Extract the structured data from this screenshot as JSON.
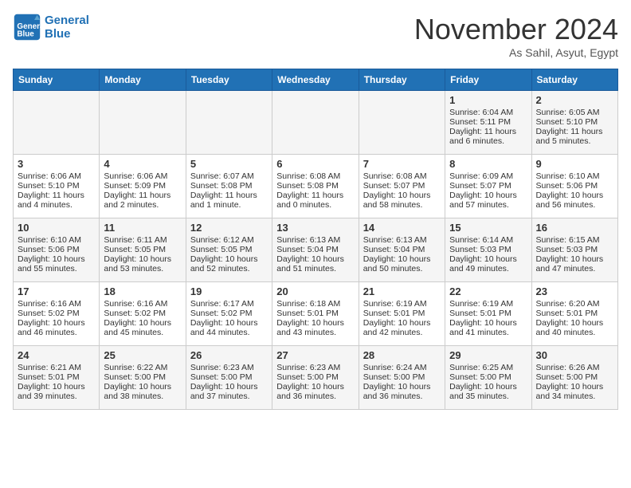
{
  "header": {
    "logo_line1": "General",
    "logo_line2": "Blue",
    "month": "November 2024",
    "location": "As Sahil, Asyut, Egypt"
  },
  "days_of_week": [
    "Sunday",
    "Monday",
    "Tuesday",
    "Wednesday",
    "Thursday",
    "Friday",
    "Saturday"
  ],
  "weeks": [
    [
      {
        "day": "",
        "info": ""
      },
      {
        "day": "",
        "info": ""
      },
      {
        "day": "",
        "info": ""
      },
      {
        "day": "",
        "info": ""
      },
      {
        "day": "",
        "info": ""
      },
      {
        "day": "1",
        "info": "Sunrise: 6:04 AM\nSunset: 5:11 PM\nDaylight: 11 hours and 6 minutes."
      },
      {
        "day": "2",
        "info": "Sunrise: 6:05 AM\nSunset: 5:10 PM\nDaylight: 11 hours and 5 minutes."
      }
    ],
    [
      {
        "day": "3",
        "info": "Sunrise: 6:06 AM\nSunset: 5:10 PM\nDaylight: 11 hours and 4 minutes."
      },
      {
        "day": "4",
        "info": "Sunrise: 6:06 AM\nSunset: 5:09 PM\nDaylight: 11 hours and 2 minutes."
      },
      {
        "day": "5",
        "info": "Sunrise: 6:07 AM\nSunset: 5:08 PM\nDaylight: 11 hours and 1 minute."
      },
      {
        "day": "6",
        "info": "Sunrise: 6:08 AM\nSunset: 5:08 PM\nDaylight: 11 hours and 0 minutes."
      },
      {
        "day": "7",
        "info": "Sunrise: 6:08 AM\nSunset: 5:07 PM\nDaylight: 10 hours and 58 minutes."
      },
      {
        "day": "8",
        "info": "Sunrise: 6:09 AM\nSunset: 5:07 PM\nDaylight: 10 hours and 57 minutes."
      },
      {
        "day": "9",
        "info": "Sunrise: 6:10 AM\nSunset: 5:06 PM\nDaylight: 10 hours and 56 minutes."
      }
    ],
    [
      {
        "day": "10",
        "info": "Sunrise: 6:10 AM\nSunset: 5:06 PM\nDaylight: 10 hours and 55 minutes."
      },
      {
        "day": "11",
        "info": "Sunrise: 6:11 AM\nSunset: 5:05 PM\nDaylight: 10 hours and 53 minutes."
      },
      {
        "day": "12",
        "info": "Sunrise: 6:12 AM\nSunset: 5:05 PM\nDaylight: 10 hours and 52 minutes."
      },
      {
        "day": "13",
        "info": "Sunrise: 6:13 AM\nSunset: 5:04 PM\nDaylight: 10 hours and 51 minutes."
      },
      {
        "day": "14",
        "info": "Sunrise: 6:13 AM\nSunset: 5:04 PM\nDaylight: 10 hours and 50 minutes."
      },
      {
        "day": "15",
        "info": "Sunrise: 6:14 AM\nSunset: 5:03 PM\nDaylight: 10 hours and 49 minutes."
      },
      {
        "day": "16",
        "info": "Sunrise: 6:15 AM\nSunset: 5:03 PM\nDaylight: 10 hours and 47 minutes."
      }
    ],
    [
      {
        "day": "17",
        "info": "Sunrise: 6:16 AM\nSunset: 5:02 PM\nDaylight: 10 hours and 46 minutes."
      },
      {
        "day": "18",
        "info": "Sunrise: 6:16 AM\nSunset: 5:02 PM\nDaylight: 10 hours and 45 minutes."
      },
      {
        "day": "19",
        "info": "Sunrise: 6:17 AM\nSunset: 5:02 PM\nDaylight: 10 hours and 44 minutes."
      },
      {
        "day": "20",
        "info": "Sunrise: 6:18 AM\nSunset: 5:01 PM\nDaylight: 10 hours and 43 minutes."
      },
      {
        "day": "21",
        "info": "Sunrise: 6:19 AM\nSunset: 5:01 PM\nDaylight: 10 hours and 42 minutes."
      },
      {
        "day": "22",
        "info": "Sunrise: 6:19 AM\nSunset: 5:01 PM\nDaylight: 10 hours and 41 minutes."
      },
      {
        "day": "23",
        "info": "Sunrise: 6:20 AM\nSunset: 5:01 PM\nDaylight: 10 hours and 40 minutes."
      }
    ],
    [
      {
        "day": "24",
        "info": "Sunrise: 6:21 AM\nSunset: 5:01 PM\nDaylight: 10 hours and 39 minutes."
      },
      {
        "day": "25",
        "info": "Sunrise: 6:22 AM\nSunset: 5:00 PM\nDaylight: 10 hours and 38 minutes."
      },
      {
        "day": "26",
        "info": "Sunrise: 6:23 AM\nSunset: 5:00 PM\nDaylight: 10 hours and 37 minutes."
      },
      {
        "day": "27",
        "info": "Sunrise: 6:23 AM\nSunset: 5:00 PM\nDaylight: 10 hours and 36 minutes."
      },
      {
        "day": "28",
        "info": "Sunrise: 6:24 AM\nSunset: 5:00 PM\nDaylight: 10 hours and 36 minutes."
      },
      {
        "day": "29",
        "info": "Sunrise: 6:25 AM\nSunset: 5:00 PM\nDaylight: 10 hours and 35 minutes."
      },
      {
        "day": "30",
        "info": "Sunrise: 6:26 AM\nSunset: 5:00 PM\nDaylight: 10 hours and 34 minutes."
      }
    ]
  ]
}
